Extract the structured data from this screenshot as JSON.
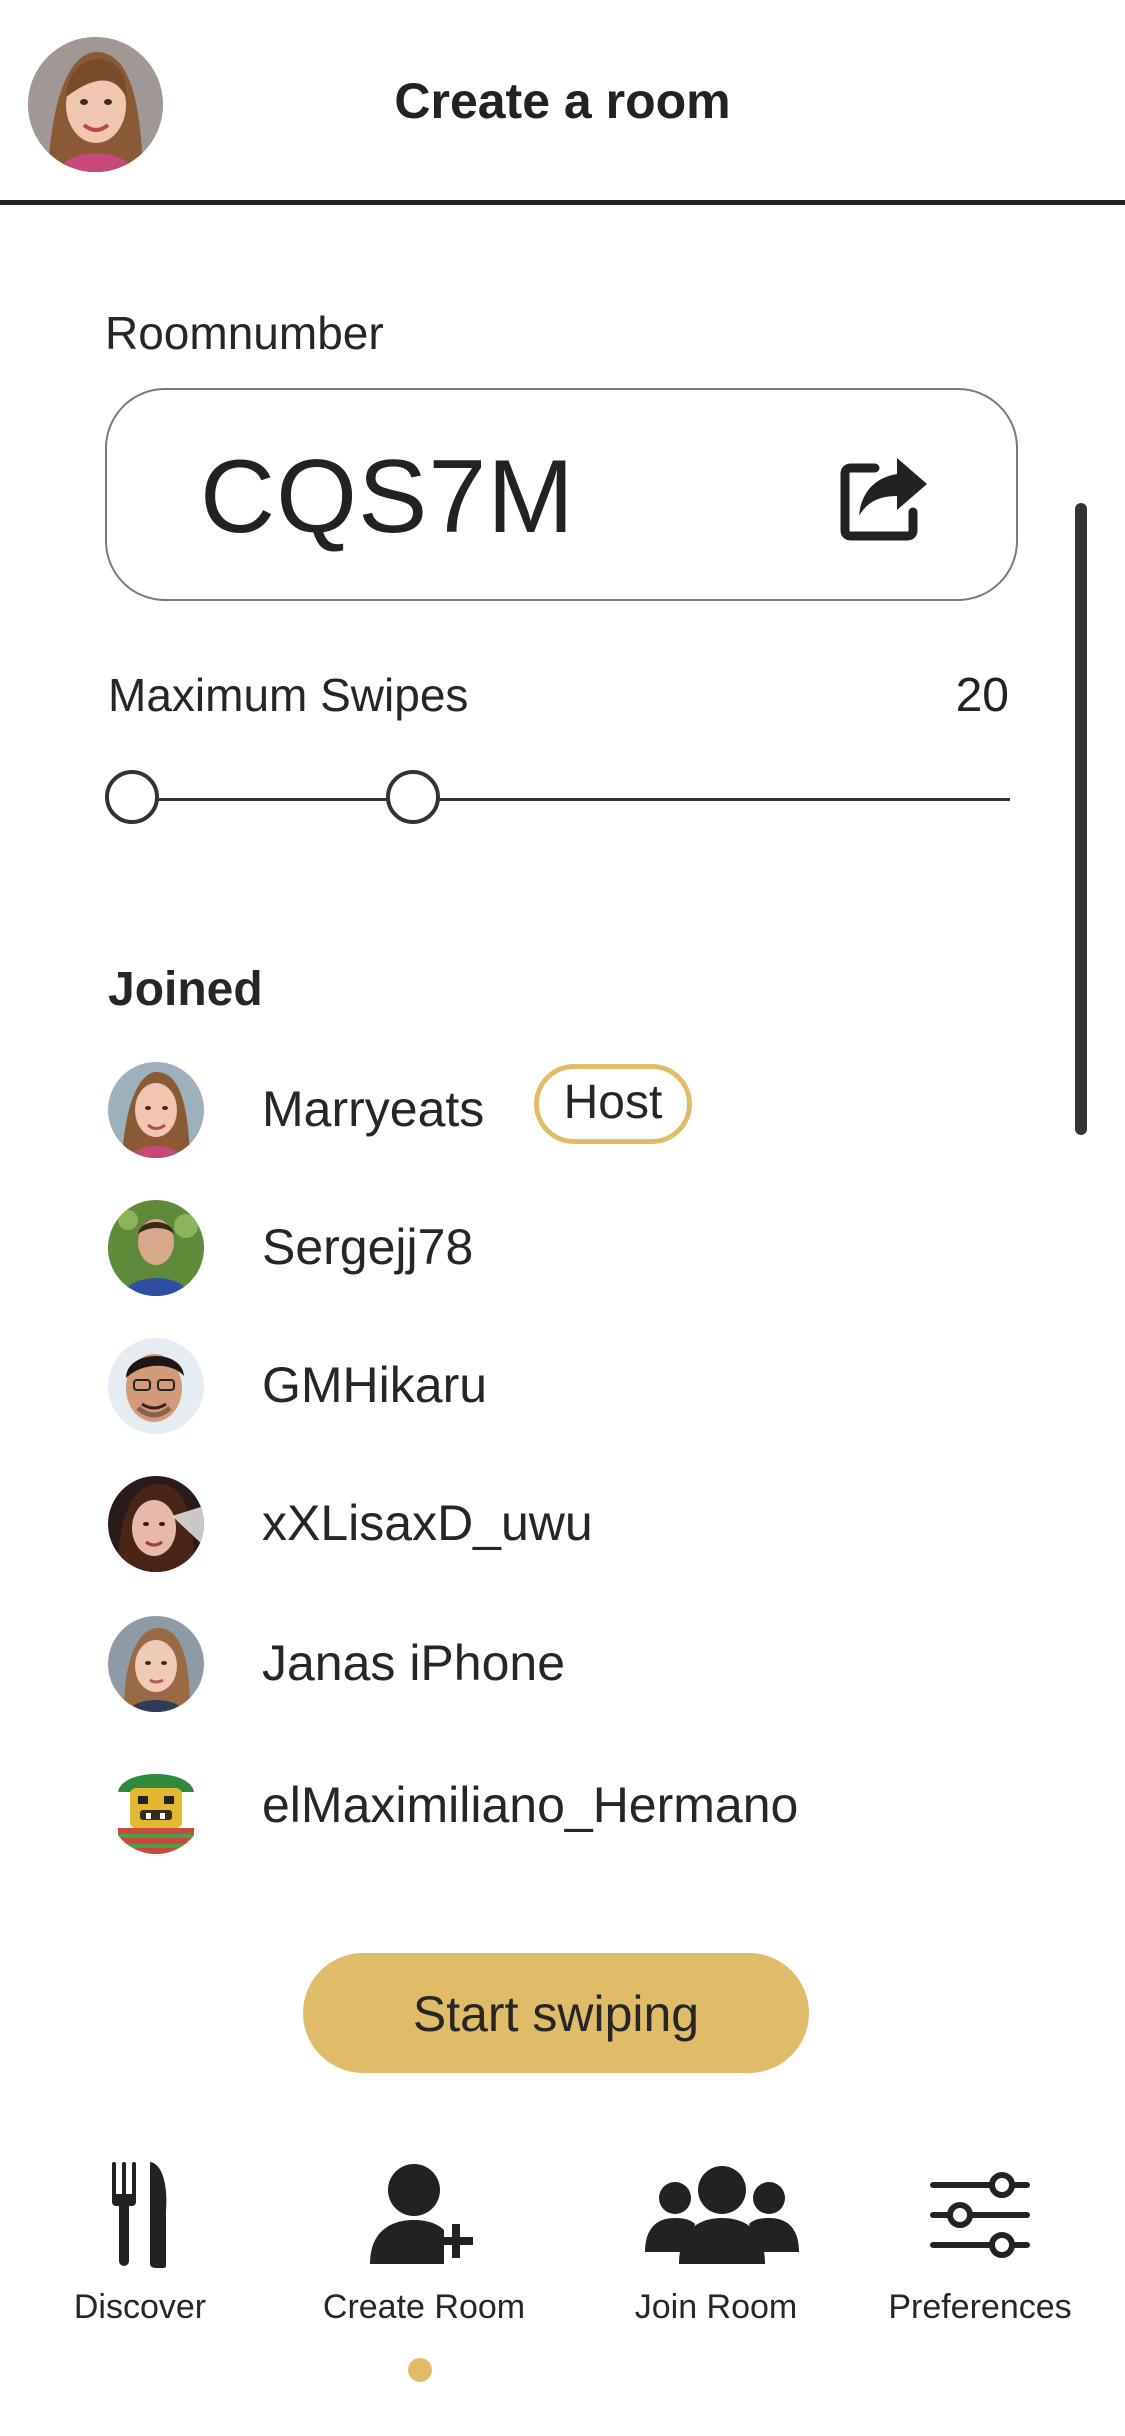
{
  "header": {
    "title": "Create a room",
    "avatar": "user-avatar"
  },
  "room": {
    "label": "Roomnumber",
    "code": "CQS7M",
    "share_icon": "share-icon"
  },
  "swipes": {
    "label": "Maximum Swipes",
    "value": "20",
    "slider_min_fraction": 0.0,
    "slider_max_fraction": 0.33
  },
  "joined": {
    "title": "Joined",
    "users": [
      {
        "name": "Marryeats",
        "badge": "Host"
      },
      {
        "name": "Sergejj78"
      },
      {
        "name": "GMHikaru"
      },
      {
        "name": "xXLisaxD_uwu"
      },
      {
        "name": "Janas iPhone"
      },
      {
        "name": "elMaximiliano_Hermano"
      }
    ]
  },
  "actions": {
    "start_label": "Start swiping"
  },
  "nav": {
    "items": [
      {
        "label": "Discover",
        "icon": "fork-knife-icon"
      },
      {
        "label": "Create Room",
        "icon": "add-user-icon",
        "active": true
      },
      {
        "label": "Join Room",
        "icon": "group-icon"
      },
      {
        "label": "Preferences",
        "icon": "sliders-icon"
      }
    ]
  },
  "colors": {
    "accent": "#e1bc68",
    "text": "#262626",
    "divider": "#222222"
  }
}
